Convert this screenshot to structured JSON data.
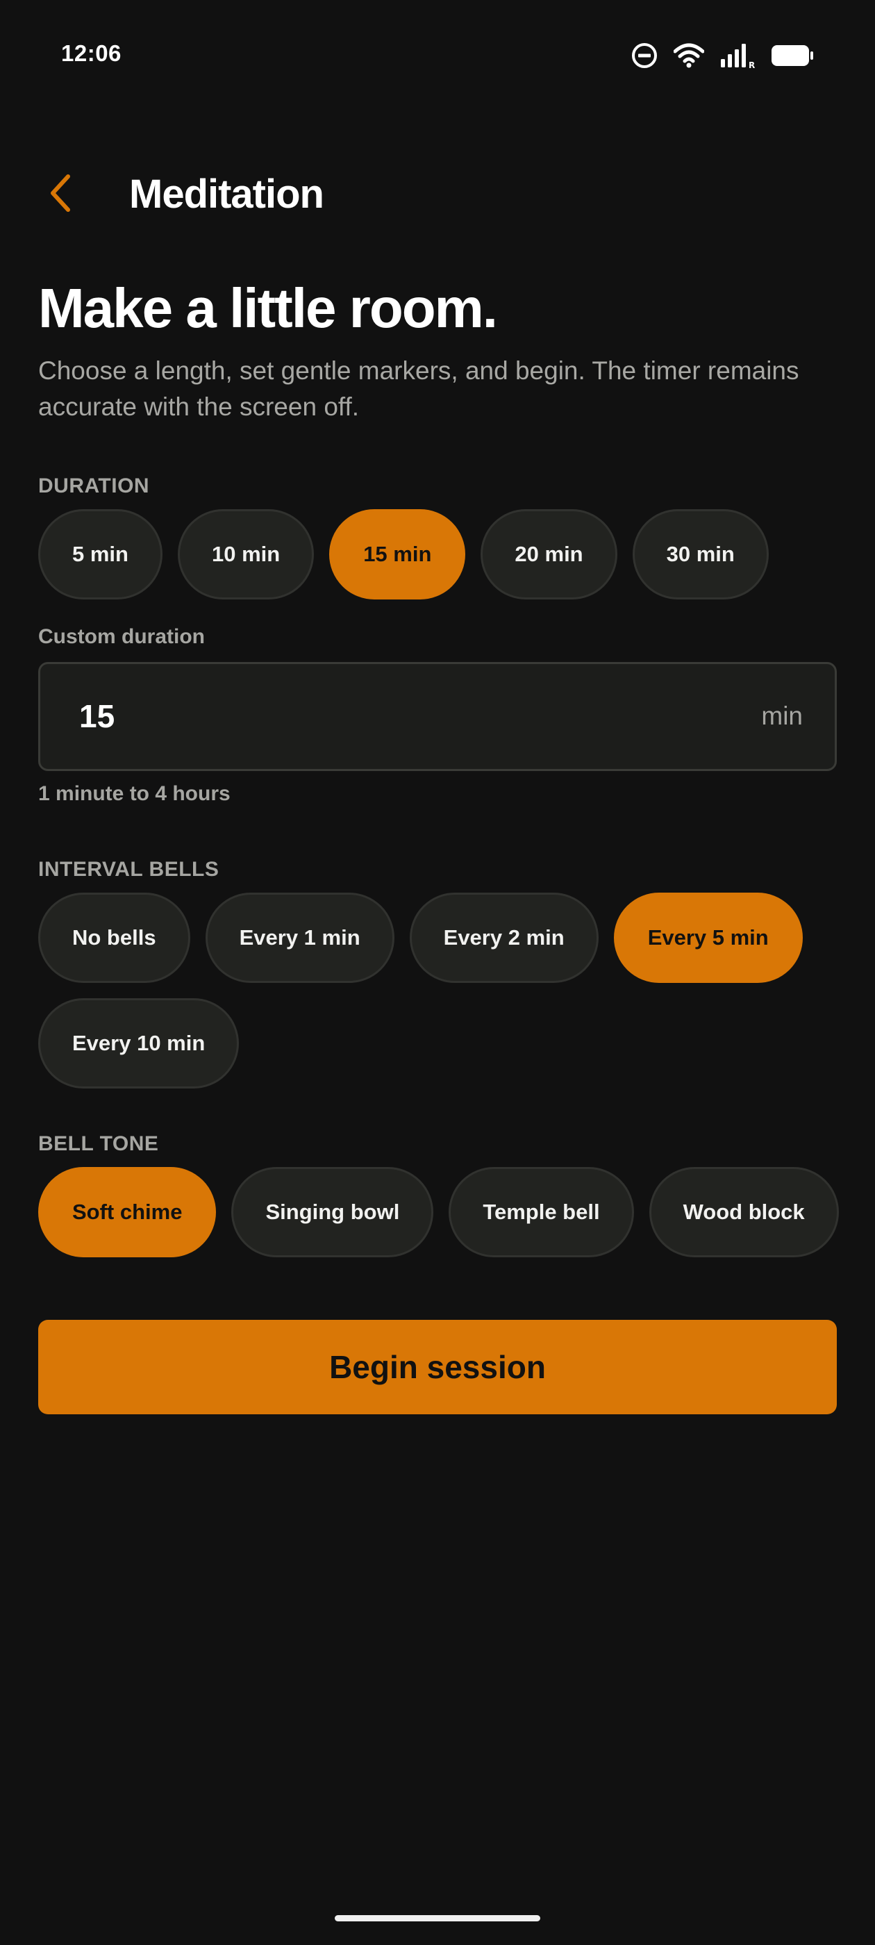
{
  "status_bar": {
    "time": "12:06",
    "icons": [
      "do-not-disturb-icon",
      "wifi-icon",
      "signal-icon",
      "battery-icon"
    ]
  },
  "app_bar": {
    "back_icon": "chevron-left-icon",
    "title": "Meditation"
  },
  "hero": {
    "title": "Make a little room.",
    "subtitle": "Choose a length, set gentle markers, and begin. The timer remains accurate with the screen off."
  },
  "duration": {
    "label": "DURATION",
    "options": [
      "5 min",
      "10 min",
      "15 min",
      "20 min",
      "30 min"
    ],
    "selected": "15 min"
  },
  "custom_duration": {
    "label": "Custom duration",
    "value": "15",
    "unit": "min",
    "helper": "1 minute to 4 hours"
  },
  "interval_bells": {
    "label": "INTERVAL BELLS",
    "options": [
      "No bells",
      "Every 1 min",
      "Every 2 min",
      "Every 5 min",
      "Every 10 min"
    ],
    "selected": "Every 5 min"
  },
  "bell_tone": {
    "label": "BELL TONE",
    "options": [
      "Soft chime",
      "Singing bowl",
      "Temple bell",
      "Wood block"
    ],
    "selected": "Soft chime"
  },
  "begin_button": {
    "label": "Begin session"
  },
  "colors": {
    "accent": "#d97706",
    "background": "#111111",
    "chip": "#222320"
  }
}
